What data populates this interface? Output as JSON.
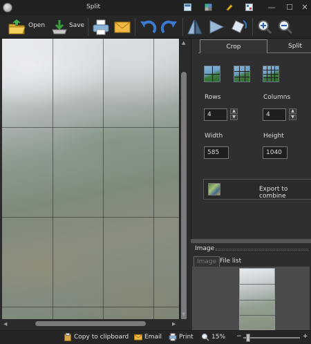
{
  "window": {
    "title": "Split",
    "minimize": "—",
    "maximize": "☐",
    "close": "✕"
  },
  "toolbar": {
    "open_label": "Open",
    "save_label": "Save"
  },
  "crop_panel": {
    "tabs": [
      "Crop",
      "Split"
    ],
    "active_tab": "Crop",
    "rows_label": "Rows",
    "rows_value": "4",
    "columns_label": "Columns",
    "columns_value": "4",
    "width_label": "Width",
    "width_value": "585",
    "height_label": "Height",
    "height_value": "1040",
    "export_label": "Export to combine"
  },
  "image_panel": {
    "title": "Image",
    "tabs": [
      "Image",
      "File list"
    ],
    "active_tab": "Image"
  },
  "statusbar": {
    "copy_label": "Copy to clipboard",
    "email_label": "Email",
    "print_label": "Print",
    "zoom_value": "15%",
    "minus": "−",
    "plus": "+"
  },
  "colors": {
    "window_bg": "#2b2b2b",
    "accent_blue": "#2f5f9f"
  }
}
